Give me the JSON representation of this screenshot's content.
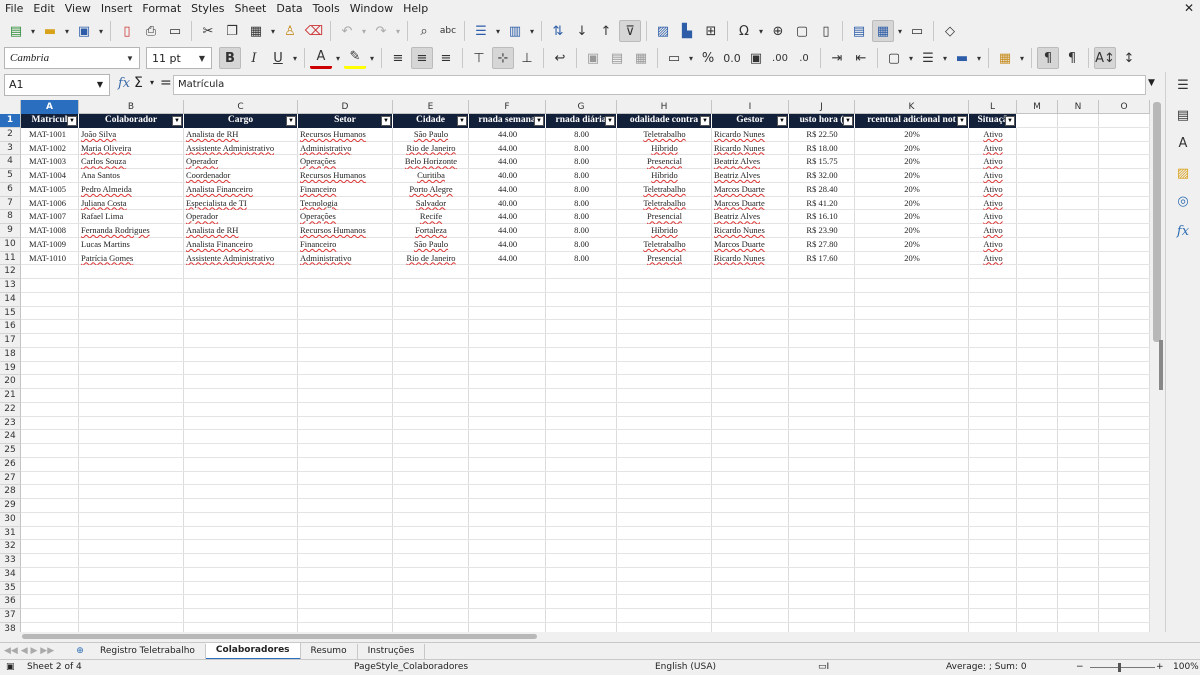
{
  "menu": [
    "File",
    "Edit",
    "View",
    "Insert",
    "Format",
    "Styles",
    "Sheet",
    "Data",
    "Tools",
    "Window",
    "Help"
  ],
  "toolbar": {
    "font_name": "Cambria",
    "font_size": "11 pt"
  },
  "formula_bar": {
    "cell_ref": "A1",
    "content": "Matrícula"
  },
  "columns": [
    "A",
    "B",
    "C",
    "D",
    "E",
    "F",
    "G",
    "H",
    "I",
    "J",
    "K",
    "L",
    "M",
    "N",
    "O"
  ],
  "table_headers": [
    "Matrícula",
    "Colaborador",
    "Cargo",
    "Setor",
    "Cidade",
    "Jornada semanal",
    "Jornada diária",
    "Modalidade contratual",
    "Gestor",
    "Custo hora (R$)",
    "Percentual adicional noturno",
    "Situação"
  ],
  "header_display": [
    "Matricul",
    "Colaborador",
    "Cargo",
    "Setor",
    "Cidade",
    "rnada semana",
    "rnada diária",
    "odalidade contra",
    "Gestor",
    "usto hora (",
    "rcentual adicional not",
    "Situaçã"
  ],
  "rows": [
    [
      "MAT-1001",
      "João Silva",
      "Analista de RH",
      "Recursos Humanos",
      "São Paulo",
      "44.00",
      "8.00",
      "Teletrabalho",
      "Ricardo Nunes",
      "R$ 22.50",
      "20%",
      "Ativo"
    ],
    [
      "MAT-1002",
      "Maria Oliveira",
      "Assistente Administrativo",
      "Administrativo",
      "Rio de Janeiro",
      "44.00",
      "8.00",
      "Híbrido",
      "Ricardo Nunes",
      "R$ 18.00",
      "20%",
      "Ativo"
    ],
    [
      "MAT-1003",
      "Carlos Souza",
      "Operador",
      "Operações",
      "Belo Horizonte",
      "44.00",
      "8.00",
      "Presencial",
      "Beatriz Alves",
      "R$ 15.75",
      "20%",
      "Ativo"
    ],
    [
      "MAT-1004",
      "Ana Santos",
      "Coordenador",
      "Recursos Humanos",
      "Curitiba",
      "40.00",
      "8.00",
      "Híbrido",
      "Beatriz Alves",
      "R$ 32.00",
      "20%",
      "Ativo"
    ],
    [
      "MAT-1005",
      "Pedro Almeida",
      "Analista Financeiro",
      "Financeiro",
      "Porto Alegre",
      "44.00",
      "8.00",
      "Teletrabalho",
      "Marcos Duarte",
      "R$ 28.40",
      "20%",
      "Ativo"
    ],
    [
      "MAT-1006",
      "Juliana Costa",
      "Especialista de TI",
      "Tecnologia",
      "Salvador",
      "40.00",
      "8.00",
      "Teletrabalho",
      "Marcos Duarte",
      "R$ 41.20",
      "20%",
      "Ativo"
    ],
    [
      "MAT-1007",
      "Rafael Lima",
      "Operador",
      "Operações",
      "Recife",
      "44.00",
      "8.00",
      "Presencial",
      "Beatriz Alves",
      "R$ 16.10",
      "20%",
      "Ativo"
    ],
    [
      "MAT-1008",
      "Fernanda Rodrigues",
      "Analista de RH",
      "Recursos Humanos",
      "Fortaleza",
      "44.00",
      "8.00",
      "Híbrido",
      "Ricardo Nunes",
      "R$ 23.90",
      "20%",
      "Ativo"
    ],
    [
      "MAT-1009",
      "Lucas Martins",
      "Analista Financeiro",
      "Financeiro",
      "São Paulo",
      "44.00",
      "8.00",
      "Teletrabalho",
      "Marcos Duarte",
      "R$ 27.80",
      "20%",
      "Ativo"
    ],
    [
      "MAT-1010",
      "Patrícia Gomes",
      "Assistente Administrativo",
      "Administrativo",
      "Rio de Janeiro",
      "44.00",
      "8.00",
      "Presencial",
      "Ricardo Nunes",
      "R$ 17.60",
      "20%",
      "Ativo"
    ]
  ],
  "visible_row_count": 38,
  "sheet_tabs": [
    "Registro Teletrabalho",
    "Colaboradores",
    "Resumo",
    "Instruções"
  ],
  "active_sheet": "Colaboradores",
  "status": {
    "sheet_pos": "Sheet 2 of 4",
    "page_style": "PageStyle_Colaboradores",
    "language": "English (USA)",
    "selection_stats": "Average: ; Sum: 0",
    "zoom": "100%"
  },
  "colors": {
    "header_bg": "#13203a",
    "selection": "#2a6fbf",
    "accent_icons": "#2d6db3"
  }
}
